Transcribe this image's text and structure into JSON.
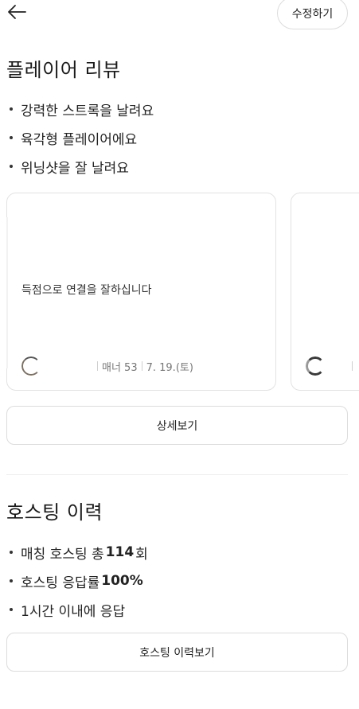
{
  "header": {
    "back_icon": "arrow-left-icon",
    "edit_label": "수정하기"
  },
  "review_section": {
    "title": "플레이어 리뷰",
    "highlights": [
      "강력한 스트록을 날려요",
      "육각형 플레이어에요",
      "위닝샷을 잘 날려요"
    ],
    "cards": [
      {
        "text": "득점으로 연결을 잘하십니다",
        "manner_label": "매너 53",
        "date": "7. 19.(토)"
      },
      {
        "text": "",
        "manner_label": "",
        "date": ""
      }
    ],
    "detail_button": "상세보기"
  },
  "hosting_section": {
    "title": "호스팅 이력",
    "items": [
      {
        "prefix": "매칭 호스팅 총 ",
        "strong": "114",
        "suffix": "회"
      },
      {
        "prefix": "호스팅 응답률 ",
        "strong": "100%",
        "suffix": ""
      },
      {
        "prefix": "1시간 이내에 응답",
        "strong": "",
        "suffix": ""
      }
    ],
    "history_button": "호스팅 이력보기"
  }
}
